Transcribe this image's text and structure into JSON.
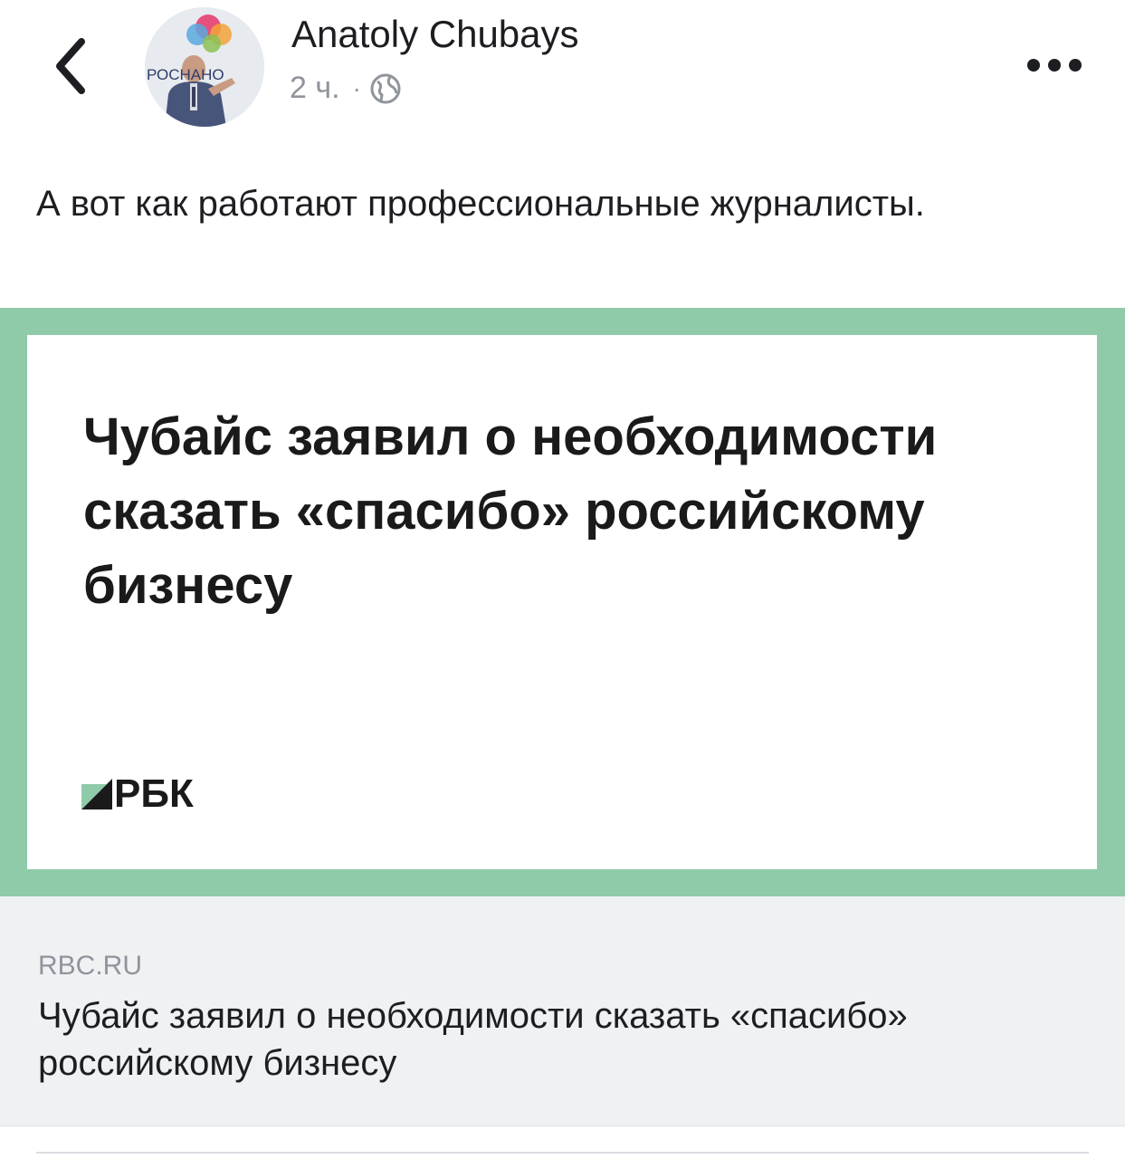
{
  "header": {
    "back_icon": "chevron-left-icon",
    "author_name": "Anatoly Chubays",
    "timestamp": "2 ч.",
    "separator": "·",
    "privacy_icon": "globe-icon",
    "more_icon": "more-horizontal-icon"
  },
  "avatar": {
    "logo_text": "РОСНАНО"
  },
  "post": {
    "text": "А вот как работают профессиональные журналисты."
  },
  "link_card": {
    "image_headline": "Чубайс заявил о необходимости сказать «спасибо» российскому бизнесу",
    "image_logo_text": "РБК",
    "domain": "RBC.RU",
    "title": "Чубайс заявил о необходимости сказать «спасибо» российскому бизнесу",
    "colors": {
      "frame": "#8fcba9",
      "footer_bg": "#f0f1f3"
    }
  }
}
